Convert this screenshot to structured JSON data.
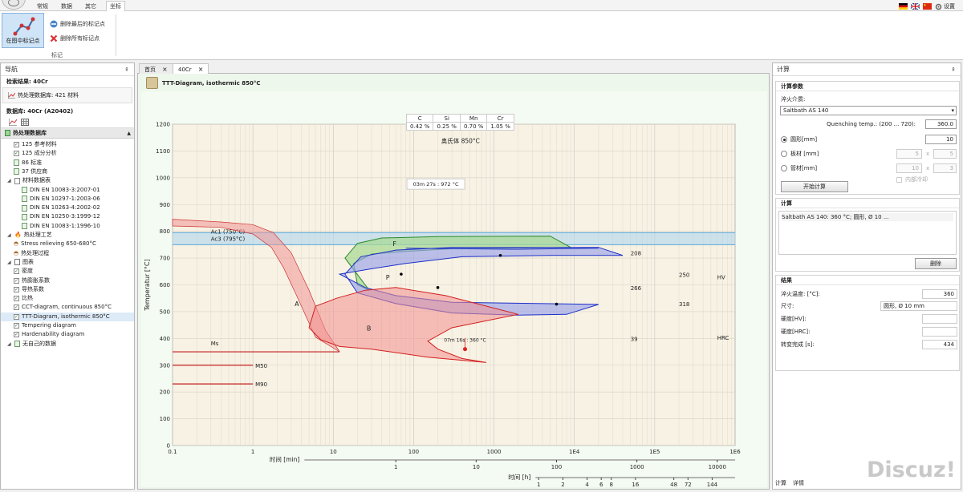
{
  "menubar": {
    "tabs": [
      "常规",
      "数据",
      "其它",
      "坐标"
    ],
    "active_tab": "坐标",
    "settings_label": "设置"
  },
  "ribbon": {
    "mark_in_chart_label": "在图中标记点",
    "delete_last_label": "删除最后的标记点",
    "delete_all_label": "删除所有标记点",
    "group_label": "标记"
  },
  "nav": {
    "title": "导航",
    "search_result_label": "检索结果: 40Cr",
    "heat_db_label": "热处理数据库: 421 材料",
    "database_label": "数据库: 40Cr (A20402)",
    "tree_header": "热处理数据库",
    "tree": [
      {
        "label": "125 参考材料",
        "level": 1,
        "type": "check"
      },
      {
        "label": "125 成分分析",
        "level": 1,
        "type": "check"
      },
      {
        "label": "86 标准",
        "level": 1,
        "type": "doc"
      },
      {
        "label": "37 供应商",
        "level": 1,
        "type": "doc"
      },
      {
        "label": "材料数据表",
        "level": 0,
        "type": "folder"
      },
      {
        "label": "DIN EN 10083-3:2007-01",
        "level": 2,
        "type": "doc"
      },
      {
        "label": "DIN EN 10297-1:2003-06",
        "level": 2,
        "type": "doc"
      },
      {
        "label": "DIN EN 10263-4:2002-02",
        "level": 2,
        "type": "doc"
      },
      {
        "label": "DIN EN 10250-3:1999-12",
        "level": 2,
        "type": "doc"
      },
      {
        "label": "DIN EN 10083-1:1996-10",
        "level": 2,
        "type": "doc"
      },
      {
        "label": "热处理工艺",
        "level": 0,
        "type": "fire"
      },
      {
        "label": "Stress relieving 650-680°C",
        "level": 1,
        "type": "pot"
      },
      {
        "label": "热处理过程",
        "level": 1,
        "type": "pot"
      },
      {
        "label": "图表",
        "level": 0,
        "type": "chart"
      },
      {
        "label": "密度",
        "level": 1,
        "type": "check"
      },
      {
        "label": "热膨胀系数",
        "level": 1,
        "type": "check"
      },
      {
        "label": "导热系数",
        "level": 1,
        "type": "check"
      },
      {
        "label": "比热",
        "level": 1,
        "type": "check"
      },
      {
        "label": "CCT-diagram, continuous 850°C",
        "level": 1,
        "type": "check"
      },
      {
        "label": "TTT-Diagram, isothermic 850°C",
        "level": 1,
        "type": "check",
        "selected": true
      },
      {
        "label": "Tempering diagram",
        "level": 1,
        "type": "check"
      },
      {
        "label": "Hardenability diagram",
        "level": 1,
        "type": "check"
      },
      {
        "label": "无自己的数据",
        "level": 0,
        "type": "doc"
      }
    ]
  },
  "doc_tabs": [
    {
      "label": "首页",
      "active": false
    },
    {
      "label": "40Cr",
      "active": true
    }
  ],
  "document": {
    "title": "TTT-Diagram, isothermic 850°C",
    "composition": {
      "elements": [
        "C",
        "Si",
        "Mn",
        "Cr"
      ],
      "values": [
        "0.42 %",
        "0.25 %",
        "0.70 %",
        "1.05 %"
      ]
    }
  },
  "chart_data": {
    "type": "line",
    "title": "",
    "austenite_label": "奥氏体 850°C",
    "xlabel_min": "时间 [min]",
    "xlabel_h": "时间 [h]",
    "xlabel_s": "",
    "ylabel": "Temperatur [°C]",
    "x_scale": "log",
    "xlim": [
      0.1,
      1000000
    ],
    "ylim": [
      0,
      1200
    ],
    "x_ticks": [
      "0.1",
      "1",
      "10",
      "100",
      "1000",
      "1E4",
      "1E5",
      "1E6"
    ],
    "y_ticks": [
      0,
      100,
      200,
      300,
      400,
      500,
      600,
      700,
      800,
      900,
      1000,
      1100,
      1200
    ],
    "min_ticks": [
      "1",
      "10",
      "100",
      "1000",
      "10000"
    ],
    "h_ticks": [
      "1",
      "2",
      "4",
      "6",
      "8",
      "16",
      "48",
      "72",
      "144"
    ],
    "grid": true,
    "lines": [
      {
        "label": "Ac3 (795°C)",
        "y": 795
      },
      {
        "label": "Ac1 (750°C)",
        "y": 750
      },
      {
        "label": "Ms",
        "y": 350
      },
      {
        "label": "M50",
        "y": 300
      },
      {
        "label": "M90",
        "y": 230
      }
    ],
    "regions": [
      {
        "label": "A"
      },
      {
        "label": "F"
      },
      {
        "label": "P"
      },
      {
        "label": "B"
      }
    ],
    "hardness": {
      "HV_label": "HV",
      "HRC_label": "HRC",
      "values": [
        {
          "label": "208",
          "y": 710
        },
        {
          "label": "250",
          "y": 630
        },
        {
          "label": "266",
          "y": 580
        },
        {
          "label": "318",
          "y": 520
        },
        {
          "label": "39",
          "y": 390
        }
      ]
    },
    "marker_top": {
      "label": "03m 27s : 972 °C",
      "x": 3.45,
      "y": 972
    },
    "marker_bottom": {
      "label": "07m 16s : 360 °C",
      "x": 7.27,
      "y": 360
    }
  },
  "calc": {
    "title": "计算",
    "params_title": "计算参数",
    "quench_label": "淬火介质:",
    "quench_value": "Saltbath AS 140",
    "quench_temp_label": "Quenching temp.: (200 ... 720):",
    "quench_temp_value": "360.0",
    "round_label": "圆形[mm]",
    "round_value": "10",
    "plate_label": "板材 [mm]",
    "plate_a": "5",
    "plate_b": "5",
    "tube_label": "管材[mm]",
    "tube_a": "10",
    "tube_b": "3",
    "inner_cool_label": "内部冷却",
    "x_label": "x",
    "start_label": "开始计算",
    "calc_title": "计算",
    "calc_item": "Saltbath AS 140: 360 °C; 圆形, Ø 10 ...",
    "delete_label": "删除",
    "result_title": "结果",
    "res_quench_temp_label": "淬火温度: [°C]:",
    "res_quench_temp_value": "360",
    "res_size_label": "尺寸:",
    "res_size_value": "圆形, Ø 10 mm",
    "res_hv_label": "硬度[HV]:",
    "res_hv_value": "",
    "res_hrc_label": "硬度[HRC]:",
    "res_hrc_value": "",
    "res_time_label": "转变完成 [s]:",
    "res_time_value": "434",
    "bottom_tabs": [
      "计算",
      "详情"
    ]
  },
  "watermark": "Discuz!"
}
